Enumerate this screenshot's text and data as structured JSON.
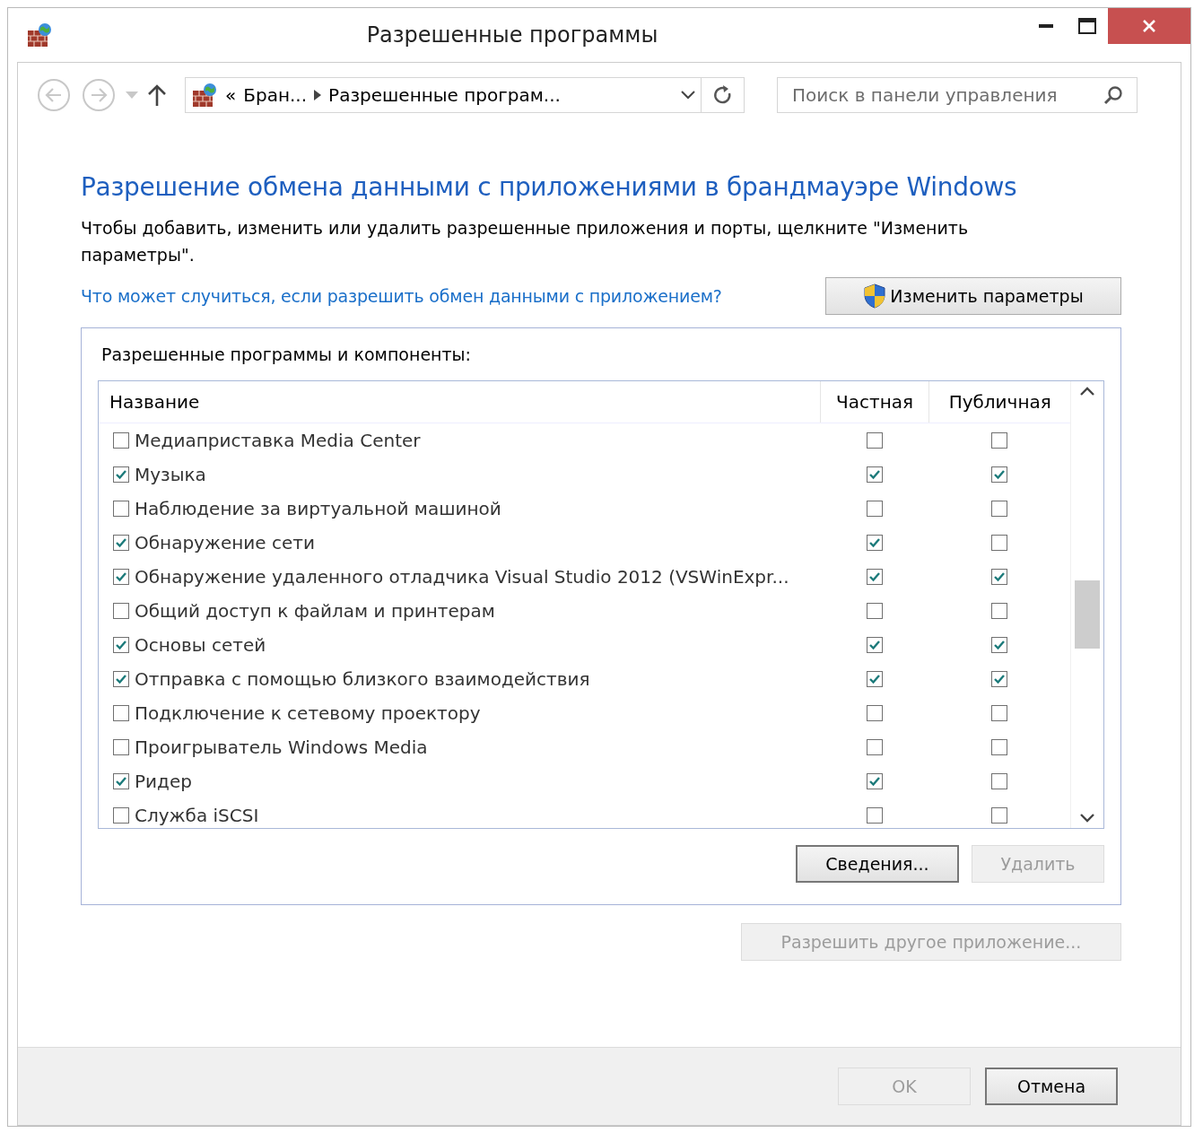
{
  "window": {
    "title": "Разрешенные программы"
  },
  "nav": {
    "back_disabled": true,
    "forward_disabled": true,
    "breadcrumb": [
      "«",
      "Бран...",
      "Разрешенные програм..."
    ],
    "search": {
      "placeholder": "Поиск в панели управления"
    }
  },
  "heading": "Разрешение обмена данными с приложениями в брандмауэре Windows",
  "description": "Чтобы добавить, изменить или удалить разрешенные приложения и порты, щелкните \"Изменить параметры\".",
  "help_link": "Что может случиться, если разрешить обмен данными с приложением?",
  "change_settings_button": {
    "label": "Изменить параметры",
    "disabled": false
  },
  "group": {
    "title": "Разрешенные программы и компоненты:",
    "table": {
      "columns": [
        "Название",
        "Частная",
        "Публичная"
      ],
      "rows": [
        {
          "name": "Медиаприставка Media Center",
          "checked": false,
          "private": false,
          "public": false
        },
        {
          "name": "Музыка",
          "checked": true,
          "private": true,
          "public": true
        },
        {
          "name": "Наблюдение за виртуальной машиной",
          "checked": false,
          "private": false,
          "public": false
        },
        {
          "name": "Обнаружение сети",
          "checked": true,
          "private": true,
          "public": false
        },
        {
          "name": "Обнаружение удаленного отладчика Visual Studio 2012 (VSWinExpr...",
          "checked": true,
          "private": true,
          "public": true
        },
        {
          "name": "Общий доступ к файлам и принтерам",
          "checked": false,
          "private": false,
          "public": false
        },
        {
          "name": "Основы сетей",
          "checked": true,
          "private": true,
          "public": true
        },
        {
          "name": "Отправка с помощью близкого взаимодействия",
          "checked": true,
          "private": true,
          "public": true
        },
        {
          "name": "Подключение к сетевому проектору",
          "checked": false,
          "private": false,
          "public": false
        },
        {
          "name": "Проигрыватель Windows Media",
          "checked": false,
          "private": false,
          "public": false
        },
        {
          "name": "Ридер",
          "checked": true,
          "private": true,
          "public": false
        },
        {
          "name": "Служба iSCSI",
          "checked": false,
          "private": false,
          "public": false
        }
      ]
    },
    "buttons": [
      {
        "label": "Сведения...",
        "disabled": false
      },
      {
        "label": "Удалить",
        "disabled": true
      }
    ]
  },
  "allow_other_button": {
    "label": "Разрешить другое приложение...",
    "disabled": true
  },
  "footer_buttons": [
    {
      "label": "OK",
      "disabled": true
    },
    {
      "label": "Отмена",
      "disabled": false
    }
  ]
}
